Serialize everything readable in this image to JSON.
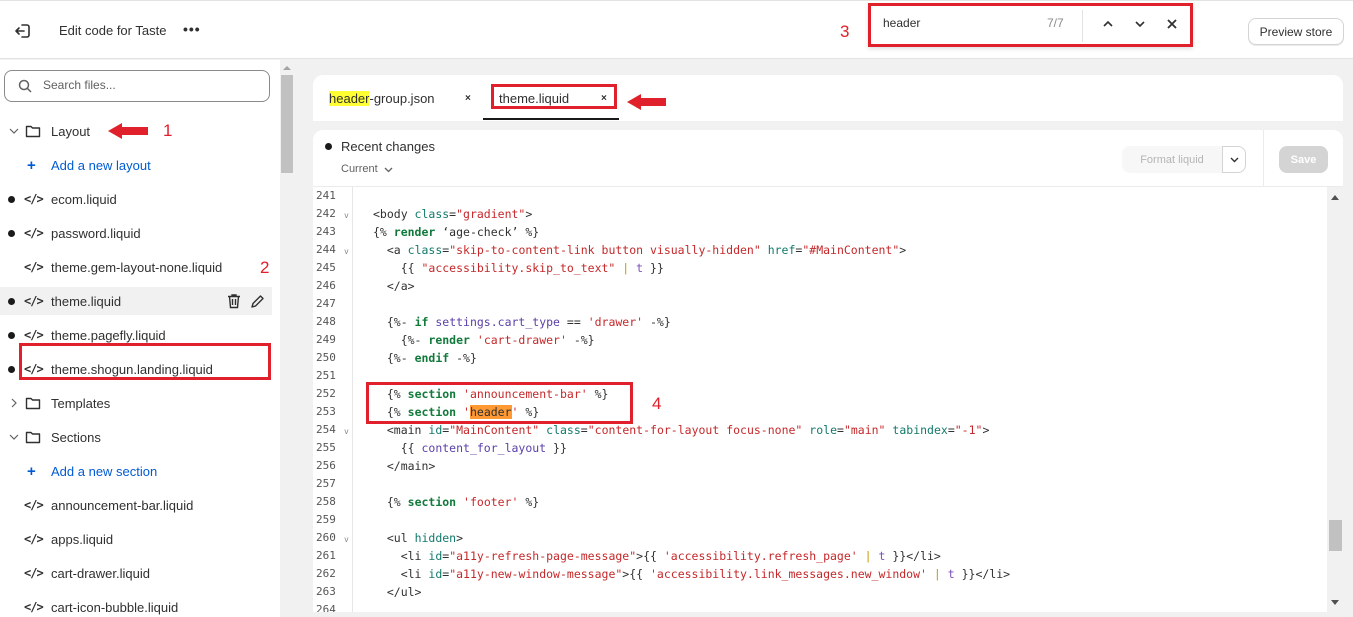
{
  "topbar": {
    "title": "Edit code for Taste",
    "more_label": "•••",
    "find": {
      "query": "header",
      "count": "7/7"
    },
    "preview_label": "Preview store"
  },
  "annotations": {
    "a1": "1",
    "a2": "2",
    "a3": "3",
    "a4": "4"
  },
  "sidebar": {
    "search_placeholder": "Search files...",
    "items": [
      {
        "type": "folder",
        "label": "Layout",
        "expanded": true
      },
      {
        "type": "add",
        "label": "Add a new layout"
      },
      {
        "type": "file",
        "label": "ecom.liquid",
        "modified": true
      },
      {
        "type": "file",
        "label": "password.liquid",
        "modified": true
      },
      {
        "type": "file",
        "label": "theme.gem-layout-none.liquid",
        "modified": false
      },
      {
        "type": "file",
        "label": "theme.liquid",
        "modified": true,
        "selected": true
      },
      {
        "type": "file",
        "label": "theme.pagefly.liquid",
        "modified": true
      },
      {
        "type": "file",
        "label": "theme.shogun.landing.liquid",
        "modified": true
      },
      {
        "type": "folder",
        "label": "Templates",
        "expanded": false
      },
      {
        "type": "folder",
        "label": "Sections",
        "expanded": true
      },
      {
        "type": "add",
        "label": "Add a new section"
      },
      {
        "type": "file",
        "label": "announcement-bar.liquid",
        "modified": false
      },
      {
        "type": "file",
        "label": "apps.liquid",
        "modified": false
      },
      {
        "type": "file",
        "label": "cart-drawer.liquid",
        "modified": false
      },
      {
        "type": "file",
        "label": "cart-icon-bubble.liquid",
        "modified": false
      }
    ]
  },
  "tabs": [
    {
      "highlight": "header",
      "rest": "-group.json",
      "close": "×"
    },
    {
      "label": "theme.liquid",
      "close": "×",
      "active": true
    }
  ],
  "editor": {
    "recent_changes": "Recent changes",
    "version": "Current",
    "format_label": "Format liquid",
    "save_label": "Save"
  },
  "code_lines": [
    {
      "n": "241",
      "fold": false,
      "html": ""
    },
    {
      "n": "242",
      "fold": true,
      "html": "<span class='t-tag'>&lt;body </span><span class='t-attr'>class</span><span class='t-tag'>=</span><span class='t-str'>\"gradient\"</span><span class='t-tag'>&gt;</span>"
    },
    {
      "n": "243",
      "fold": false,
      "html": "<span class='t-tag'>{% </span><span class='t-kw'>render</span><span class='t-tag'> ‘age-check’ %}</span>"
    },
    {
      "n": "244",
      "fold": true,
      "html": "  <span class='t-tag'>&lt;a </span><span class='t-attr'>class</span><span class='t-tag'>=</span><span class='t-str'>\"skip-to-content-link button visually-hidden\"</span> <span class='t-attr'>href</span><span class='t-tag'>=</span><span class='t-str'>\"#MainContent\"</span><span class='t-tag'>&gt;</span>"
    },
    {
      "n": "245",
      "fold": false,
      "html": "    <span class='t-tag'>{{ </span><span class='t-str'>\"accessibility.skip_to_text\"</span> <span class='t-pipe'>|</span> <span class='t-filter'>t</span><span class='t-tag'> }}</span>"
    },
    {
      "n": "246",
      "fold": false,
      "html": "  <span class='t-tag'>&lt;/a&gt;</span>"
    },
    {
      "n": "247",
      "fold": false,
      "html": ""
    },
    {
      "n": "248",
      "fold": false,
      "html": "  <span class='t-tag'>{%- </span><span class='t-kw'>if</span><span class='t-var'> settings.cart_type </span><span class='t-tag'>== </span><span class='t-str'>'drawer'</span><span class='t-tag'> -%}</span>"
    },
    {
      "n": "249",
      "fold": false,
      "html": "    <span class='t-tag'>{%- </span><span class='t-kw'>render</span> <span class='t-str'>'cart-drawer'</span><span class='t-tag'> -%}</span>"
    },
    {
      "n": "250",
      "fold": false,
      "html": "  <span class='t-tag'>{%- </span><span class='t-kw'>endif</span><span class='t-tag'> -%}</span>"
    },
    {
      "n": "251",
      "fold": false,
      "html": ""
    },
    {
      "n": "252",
      "fold": false,
      "html": "  <span class='t-tag'>{% </span><span class='t-kw'>section</span> <span class='t-str'>'announcement-bar'</span><span class='t-tag'> %}</span>"
    },
    {
      "n": "253",
      "fold": false,
      "html": "  <span class='t-tag'>{% </span><span class='t-kw'>section</span> <span class='t-str'>'</span><span class='t-match'>header</span><span class='t-str'>'</span><span class='t-tag'> %}</span>"
    },
    {
      "n": "254",
      "fold": true,
      "html": "  <span class='t-tag'>&lt;main </span><span class='t-attr'>id</span><span class='t-tag'>=</span><span class='t-str'>\"MainContent\"</span> <span class='t-attr'>class</span><span class='t-tag'>=</span><span class='t-str'>\"content-for-layout focus-none\"</span> <span class='t-attr'>role</span><span class='t-tag'>=</span><span class='t-str'>\"main\"</span> <span class='t-attr'>tabindex</span><span class='t-tag'>=</span><span class='t-str'>\"-1\"</span><span class='t-tag'>&gt;</span>"
    },
    {
      "n": "255",
      "fold": false,
      "html": "    <span class='t-tag'>{{ </span><span class='t-var'>content_for_layout</span><span class='t-tag'> }}</span>"
    },
    {
      "n": "256",
      "fold": false,
      "html": "  <span class='t-tag'>&lt;/main&gt;</span>"
    },
    {
      "n": "257",
      "fold": false,
      "html": ""
    },
    {
      "n": "258",
      "fold": false,
      "html": "  <span class='t-tag'>{% </span><span class='t-kw'>section</span> <span class='t-str'>'footer'</span><span class='t-tag'> %}</span>"
    },
    {
      "n": "259",
      "fold": false,
      "html": ""
    },
    {
      "n": "260",
      "fold": true,
      "html": "  <span class='t-tag'>&lt;ul </span><span class='t-attr'>hidden</span><span class='t-tag'>&gt;</span>"
    },
    {
      "n": "261",
      "fold": false,
      "html": "    <span class='t-tag'>&lt;li </span><span class='t-attr'>id</span><span class='t-tag'>=</span><span class='t-str'>\"a11y-refresh-page-message\"</span><span class='t-tag'>&gt;{{ </span><span class='t-str'>'accessibility.refresh_page'</span> <span class='t-pipe'>|</span> <span class='t-filter'>t</span><span class='t-tag'> }}&lt;/li&gt;</span>"
    },
    {
      "n": "262",
      "fold": false,
      "html": "    <span class='t-tag'>&lt;li </span><span class='t-attr'>id</span><span class='t-tag'>=</span><span class='t-str'>\"a11y-new-window-message\"</span><span class='t-tag'>&gt;{{ </span><span class='t-str'>'accessibility.link_messages.new_window'</span> <span class='t-pipe'>|</span> <span class='t-filter'>t</span><span class='t-tag'> }}&lt;/li&gt;</span>"
    },
    {
      "n": "263",
      "fold": false,
      "html": "  <span class='t-tag'>&lt;/ul&gt;</span>"
    },
    {
      "n": "264",
      "fold": false,
      "html": ""
    }
  ]
}
